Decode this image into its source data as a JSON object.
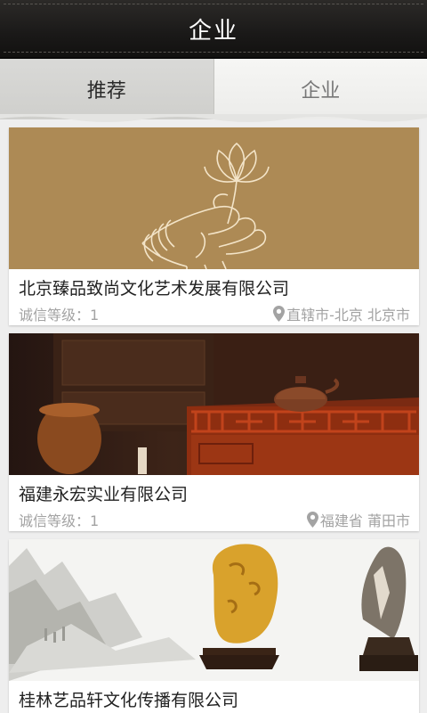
{
  "header": {
    "title": "企业"
  },
  "tabs": [
    {
      "label": "推荐",
      "active": true
    },
    {
      "label": "企业",
      "active": false
    }
  ],
  "companies": [
    {
      "name": "北京臻品致尚文化艺术发展有限公司",
      "grade": "诚信等级：1",
      "location": "直辖市-北京 北京市",
      "image": "lotus-hand-illustration"
    },
    {
      "name": "福建永宏实业有限公司",
      "grade": "诚信等级：1",
      "location": "福建省 莆田市",
      "image": "carved-wood-teapot-display"
    },
    {
      "name": "桂林艺品轩文化传播有限公司",
      "grade": "",
      "location": "",
      "image": "ink-landscape-stones"
    }
  ],
  "colors": {
    "header_bg": "#1a1918",
    "card_bg": "#ffffff",
    "muted_text": "#a3a3a3",
    "banner_gold": "#ad8a55"
  }
}
